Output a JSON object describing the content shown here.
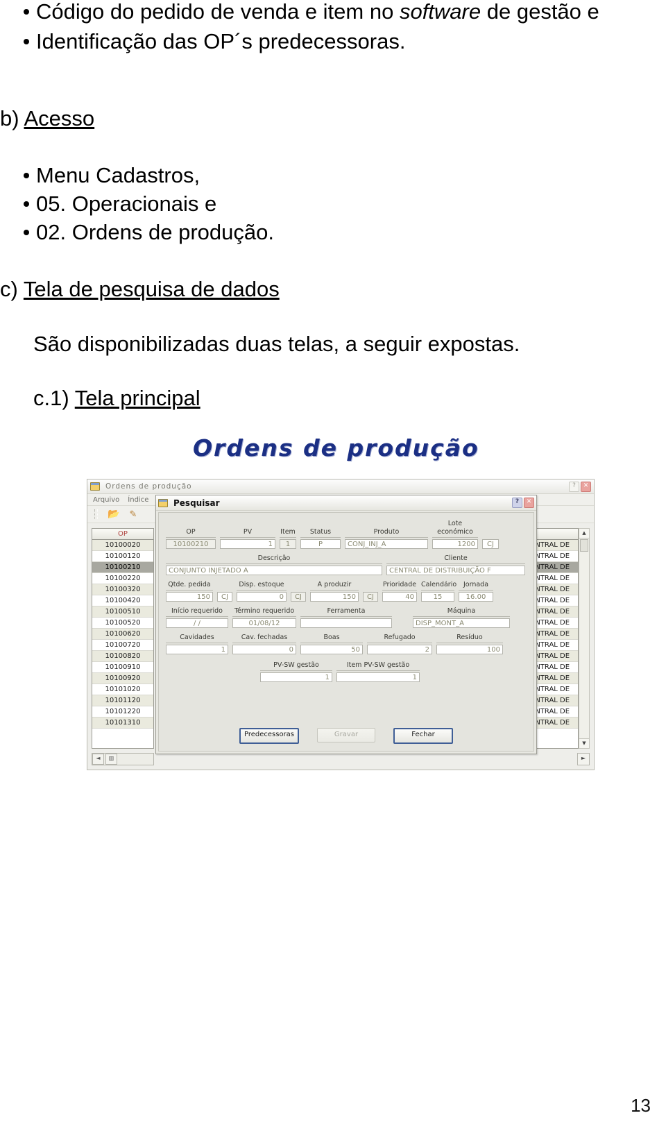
{
  "document": {
    "bullets_top": [
      "Código do pedido de venda e item no software de gestão e",
      "Identificação das OP´s predecessoras."
    ],
    "bullet_top_1_pre": "Código do pedido de venda e item no ",
    "bullet_top_1_italic": "software",
    "bullet_top_1_post": " de gestão e",
    "section_b_marker": "b)",
    "section_b_title": "Acesso",
    "bullets_access": [
      "Menu Cadastros,",
      "05. Operacionais e",
      "02. Ordens de produção."
    ],
    "section_c_marker": "c)",
    "section_c_title": "Tela de pesquisa de dados",
    "paragraph_c": "São disponibilizadas duas telas, a seguir expostas.",
    "section_c1_marker": "c.1)",
    "section_c1_title": "Tela principal",
    "page_number": "13"
  },
  "figure": {
    "wordart_title": "Ordens de produção",
    "wordart_color": "#1b2f84"
  },
  "app": {
    "window_title": "Ordens de produção",
    "menu": [
      "Arquivo",
      "Índice"
    ],
    "toolbar_icons": [
      "open-folder-icon",
      "pencil-icon"
    ],
    "window_buttons": [
      "help-button",
      "close-button"
    ],
    "help_glyph": "?",
    "close_glyph": "✕",
    "left_grid": {
      "header": "OP",
      "selected_value": "10100210",
      "rows": [
        "10100020",
        "10100120",
        "10100210",
        "10100220",
        "10100320",
        "10100420",
        "10100510",
        "10100520",
        "10100620",
        "10100720",
        "10100820",
        "10100910",
        "10100920",
        "10101020",
        "10101120",
        "10101220",
        "10101310"
      ],
      "scroll_left_glyph": "◄",
      "scroll_resize_glyph": "▥"
    },
    "right_grid": {
      "header": "",
      "selected_index": 2,
      "rows": [
        "ENTRAL DE",
        "ENTRAL DE",
        "ENTRAL DE",
        "ENTRAL DE",
        "ENTRAL DE",
        "ENTRAL DE",
        "ENTRAL DE",
        "ENTRAL DE",
        "ENTRAL DE",
        "ENTRAL DE",
        "ENTRAL DE",
        "ENTRAL DE",
        "ENTRAL DE",
        "ENTRAL DE",
        "ENTRAL DE",
        "ENTRAL DE",
        "ENTRAL DE"
      ]
    },
    "scrollbar": {
      "up_glyph": "▲",
      "down_glyph": "▼",
      "right_glyph": "►"
    }
  },
  "dialog": {
    "title": "Pesquisar",
    "help_glyph": "?",
    "close_glyph": "✕",
    "row1": {
      "op_label": "OP",
      "op_value": "10100210",
      "pv_label": "PV",
      "pv_value": "1",
      "item_label": "Item",
      "item_value": "1",
      "status_label": "Status",
      "status_value": "P",
      "produto_label": "Produto",
      "produto_value": "CONJ_INJ_A",
      "lote_label": "Lote económico",
      "lote_value": "1200",
      "lote_unit": "CJ"
    },
    "row2": {
      "descricao_label": "Descrição",
      "descricao_value": "CONJUNTO INJETADO A",
      "cliente_label": "Cliente",
      "cliente_value": "CENTRAL DE DISTRIBUIÇÃO F"
    },
    "row3": {
      "qtde_label": "Qtde. pedida",
      "qtde_value": "150",
      "qtde_unit": "CJ",
      "disp_label": "Disp. estoque",
      "disp_value": "0",
      "disp_unit": "CJ",
      "produzir_label": "A produzir",
      "produzir_value": "150",
      "produzir_unit": "CJ",
      "prioridade_label": "Prioridade",
      "prioridade_value": "40",
      "calendario_label": "Calendário",
      "calendario_value": "15",
      "jornada_label": "Jornada",
      "jornada_value": "16.00"
    },
    "row4": {
      "inicio_label": "Início requerido",
      "inicio_value": "/  /",
      "termino_label": "Término requerido",
      "termino_value": "01/08/12",
      "ferramenta_label": "Ferramenta",
      "ferramenta_value": "",
      "maquina_label": "Máquina",
      "maquina_value": "DISP_MONT_A"
    },
    "row5": {
      "cavidades_label": "Cavidades",
      "cavidades_value": "1",
      "cavfechadas_label": "Cav. fechadas",
      "cavfechadas_value": "0",
      "boas_label": "Boas",
      "boas_value": "50",
      "refugado_label": "Refugado",
      "refugado_value": "2",
      "residuo_label": "Resíduo",
      "residuo_value": "100"
    },
    "row6": {
      "pvsw_label": "PV-SW gestão",
      "pvsw_value": "1",
      "itempvsw_label": "Item PV-SW gestão",
      "itempvsw_value": "1"
    },
    "buttons": {
      "predecessoras": "Predecessoras",
      "gravar": "Gravar",
      "fechar": "Fechar"
    }
  }
}
